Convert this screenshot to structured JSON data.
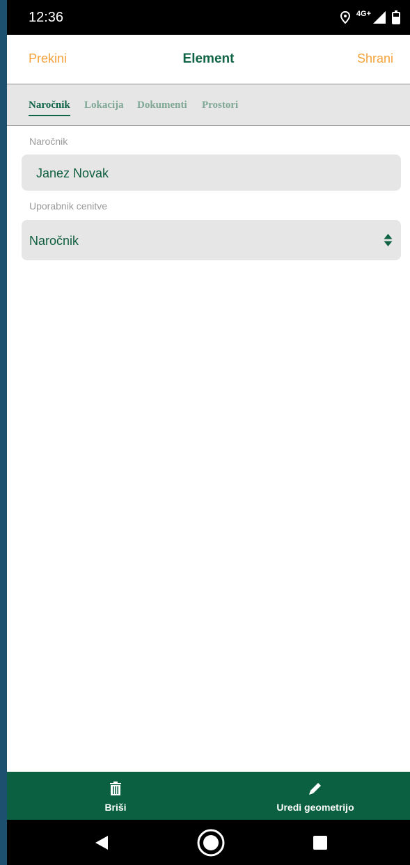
{
  "status_bar": {
    "time": "12:36",
    "network": "4G+"
  },
  "app_bar": {
    "cancel_label": "Prekini",
    "title": "Element",
    "save_label": "Shrani"
  },
  "tabs": [
    {
      "label": "Naročnik",
      "active": true
    },
    {
      "label": "Lokacija",
      "active": false
    },
    {
      "label": "Dokumenti",
      "active": false
    },
    {
      "label": "Prostori",
      "active": false
    }
  ],
  "form": {
    "client_label": "Naročnik",
    "client_value": "Janez Novak",
    "user_label": "Uporabnik cenitve",
    "user_value": "Naročnik"
  },
  "bottom_bar": {
    "delete_label": "Briši",
    "edit_geometry_label": "Uredi geometrijo"
  },
  "icons": {
    "location": "location-icon",
    "signal": "signal-icon",
    "battery": "battery-icon",
    "delete": "trash-icon",
    "edit": "pencil-icon",
    "back": "back-triangle-icon",
    "home": "home-circle-icon",
    "recents": "recents-square-icon"
  },
  "colors": {
    "accent_orange": "#f5a23a",
    "brand_green": "#0f6446",
    "bottom_bar": "#0c6042",
    "tab_inactive": "#7fa896",
    "field_bg": "#e6e6e6"
  }
}
